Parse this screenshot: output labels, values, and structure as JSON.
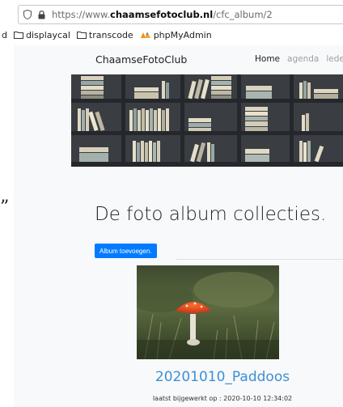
{
  "browser": {
    "url_prefix": "https://www.",
    "url_domain": "chaamsefotoclub.nl",
    "url_path": "/cfc_album/2",
    "bookmark_edge": "d",
    "bookmarks": [
      {
        "label": "displaycal",
        "icon": "folder-icon"
      },
      {
        "label": "transcode",
        "icon": "folder-icon"
      },
      {
        "label": "phpMyAdmin",
        "icon": "phpmyadmin-icon"
      }
    ]
  },
  "navbar": {
    "brand": "ChaamseFotoClub",
    "links": [
      {
        "label": "Home",
        "active": true
      },
      {
        "label": "agenda",
        "active": false
      },
      {
        "label": "leden",
        "active": false
      }
    ]
  },
  "left_glyph": "”",
  "main": {
    "heading": "De foto album collecties.",
    "add_button": "Album toevoegen.",
    "album": {
      "title": "20201010_Paddoos",
      "updated": "laatst bijgewerkt op : 2020-10-10 12:34:02"
    }
  },
  "colors": {
    "primary": "#007bff",
    "link": "#3d8fd6",
    "page_bg": "#f8f9fa"
  }
}
